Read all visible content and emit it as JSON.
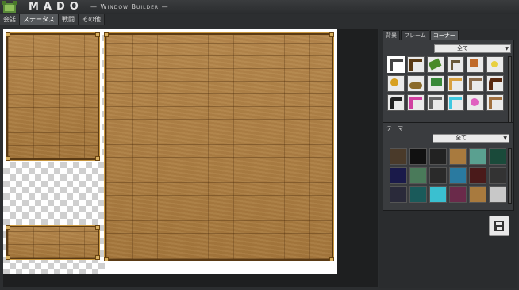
{
  "app": {
    "title": "MADO",
    "subtitle": "— Window Builder —"
  },
  "tabs": [
    {
      "label": "会話"
    },
    {
      "label": "ステータス"
    },
    {
      "label": "戦闘"
    },
    {
      "label": "その他"
    }
  ],
  "active_tab": "ステータス",
  "panel": {
    "tabs": [
      {
        "label": "背景"
      },
      {
        "label": "フレーム"
      },
      {
        "label": "コーナー"
      }
    ],
    "active_tab": "コーナー",
    "corner_filter": "全て",
    "theme_label": "テーマ",
    "theme_filter": "全て"
  },
  "colors": {
    "background": "#2c2e30",
    "wood": "#a87a3e",
    "frame": "#5a3a14"
  },
  "icons": {
    "save": "floppy-disk-icon",
    "dropdown": "chevron-down-icon"
  }
}
